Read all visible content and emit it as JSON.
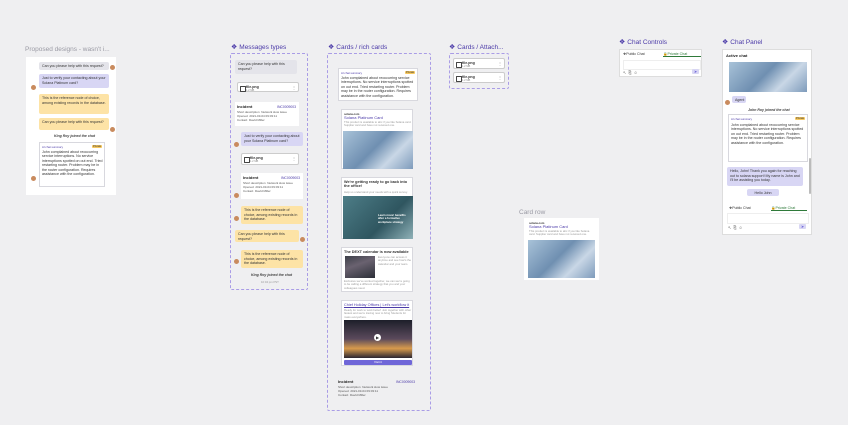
{
  "frames": {
    "proposed": {
      "title": "Proposed designs - wasn't i..."
    },
    "messages": {
      "title": "Messages types"
    },
    "cards": {
      "title": "Cards / rich cards"
    },
    "attachments": {
      "title": "Cards / Attach..."
    },
    "controls": {
      "title": "Chat Controls"
    },
    "panel": {
      "title": "Chat Panel"
    },
    "card_row": {
      "title": "Card row"
    }
  },
  "proposed": {
    "msg1": "Can you please help with this request?",
    "msg2": "Just to verify your contacting about your Solana Platinum card?",
    "msg3": "This is the reference node of choice, among existing records in the database.",
    "msg4": "Can you please help with this request?",
    "system": "King Roy joined the chat",
    "ai_label": "AI chat summary",
    "private": "Private",
    "summary": "John complained about reoccurring service interruptions. No service interruptions spotted on out end. Tried restarting router. Problem may be in the router configuration. Requires assistance with the configuration."
  },
  "messages": {
    "msg1": "Can you please help with this request?",
    "file1": {
      "name": "file.png",
      "size": "1.2 MB"
    },
    "incident1": {
      "label": "Incident",
      "number": "INC0009003",
      "rows": [
        [
          "Short description",
          "Network slow issue"
        ],
        [
          "Opened",
          "2021-03-04 09:03:11"
        ],
        [
          "Contact",
          "David Miller"
        ]
      ]
    },
    "msg2": "Just to verify your contacting about your Solana Platinum card?",
    "file2": {
      "name": "file.png",
      "size": "1.2 MB"
    },
    "incident2": {
      "label": "Incident",
      "number": "INC0009003",
      "rows": [
        [
          "Short description",
          "Network slow issue"
        ],
        [
          "Opened",
          "2021-03-04 09:03:11"
        ],
        [
          "Contact",
          "David Miller"
        ]
      ]
    },
    "msg3": "This is the reference node of choice, among existing records in the database.",
    "msg4": "Can you please help with this request?",
    "msg5": "This is the reference node of choice, among existing records in the database.",
    "system": "King Roy joined the chat",
    "ts": "10:04 pm PST"
  },
  "cards": {
    "ai_label": "AI chat summary",
    "private": "Private",
    "summary": "John complained about reoccurring service interruptions. No service interruptions spotted on out end. Tried restarting router. Problem may be in the router configuration. Requires assistance with the configuration.",
    "card1": {
      "brand": "solana.com",
      "title": "Solana Platinum Card",
      "body": "This product is available to abc if you like Solana card. Supplier card and have not received one."
    },
    "card2": {
      "title": "We're getting ready to go back into the office!",
      "body": "Help us understand your needs with a quick survey.",
      "overlay": "Learn more! benefits after a formative workplace strategy"
    },
    "card3": {
      "title": "The DEXT calendar is now available",
      "body": "Everyone can access it anytime and see how's the calendar and your team.",
      "footer": "Exclusive we've worked together, we can we're going to be calling a different strategy that you and your colleagues need."
    },
    "card4": {
      "title": "Chief Holiday Offices | Let's workflow it",
      "body": "Ready for work to work better! Join together with other fastest and we're tracing now to bring Students for mass everywhere.",
      "button": "Visit it"
    },
    "incident": {
      "label": "Incident",
      "number": "INC0009003",
      "rows": [
        [
          "Short description",
          "Network slow issue"
        ],
        [
          "Opened",
          "2021-03-04 09:03:11"
        ],
        [
          "Contact",
          "David Miller"
        ]
      ]
    }
  },
  "attachments": {
    "file1": {
      "name": "file.png",
      "size": "1.2 MB"
    },
    "file2": {
      "name": "file.png",
      "size": "1.2 MB"
    }
  },
  "controls": {
    "tab_public": "Public Chat",
    "tab_private": "Private Chat"
  },
  "panel": {
    "header": "Active chat",
    "agent": "Agent",
    "system": "John Roy joined the chat",
    "ai_label": "AI chat summary",
    "private": "Private",
    "summary": "John complained about reoccurring service interruptions. No service interruptions spotted on out end. Tried restarting router. Problem may be in the router configuration. Requires assistance with the configuration.",
    "reply": "Hello, John! Thank you again for reaching out to solana support! My name is John and I'll be assisting you today.",
    "hello": "Hello John",
    "tab_public": "Public Chat",
    "tab_private": "Private Chat"
  },
  "card_row": {
    "brand": "solana.com",
    "title": "Solana Platinum Card",
    "body": "This product is available to abc if you like Solana card. Supplier card and have not received one."
  },
  "colors": {
    "accent": "#4b3aa8",
    "purple_bubble": "#d8d6f4",
    "yellow_bubble": "#fde3a6",
    "gray_bubble": "#e4e4ea",
    "dash": "#a99ce6"
  }
}
